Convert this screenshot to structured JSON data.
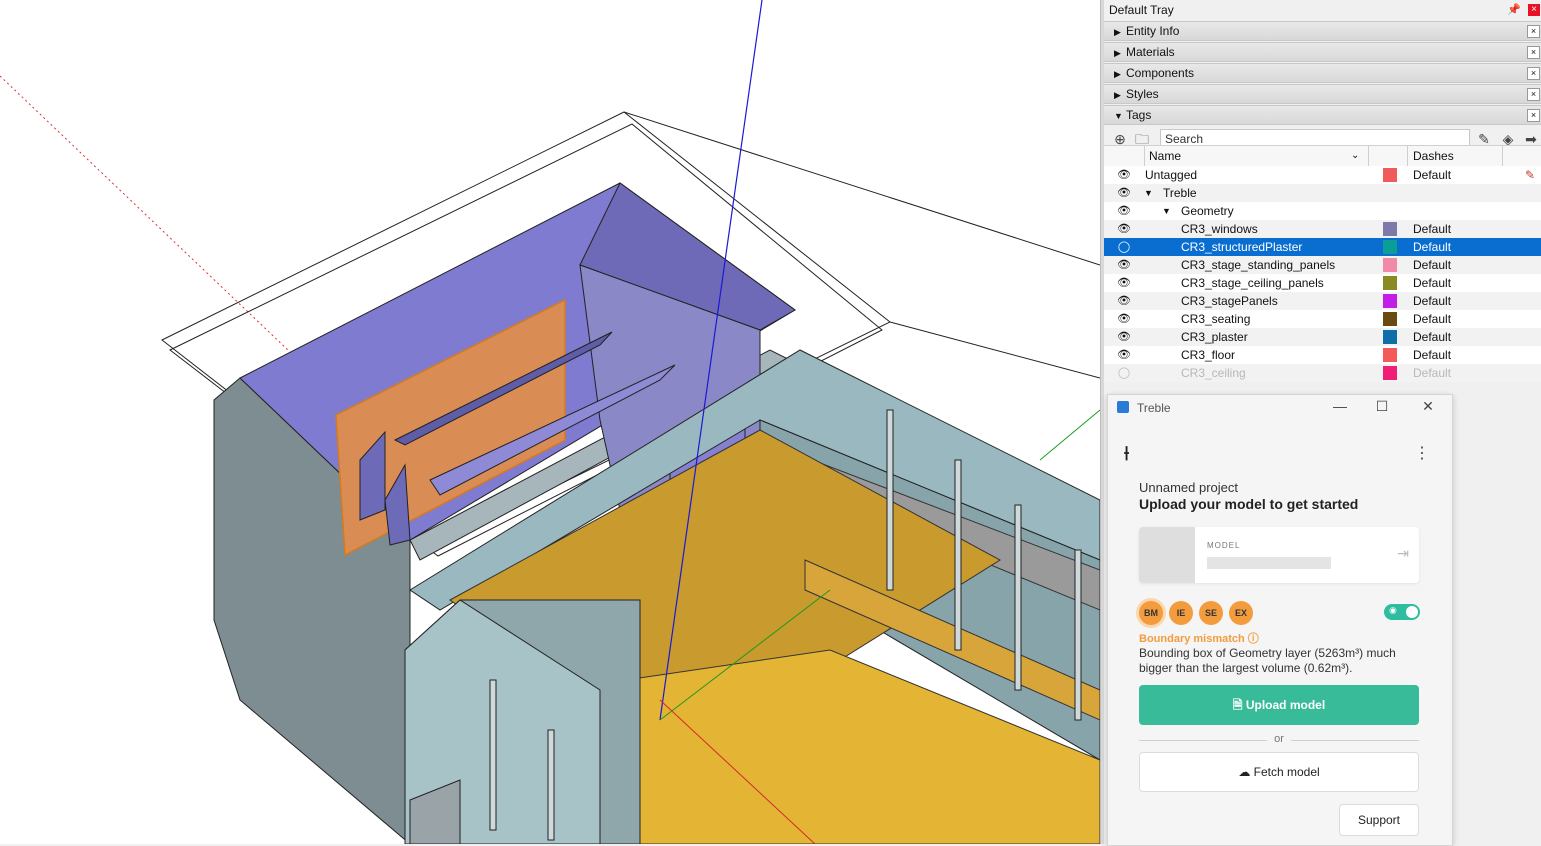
{
  "tray": {
    "title": "Default Tray",
    "pin_icon": "pin-icon",
    "close_label": "×",
    "panels": [
      {
        "label": "Entity Info",
        "expanded": false
      },
      {
        "label": "Materials",
        "expanded": false
      },
      {
        "label": "Components",
        "expanded": false
      },
      {
        "label": "Styles",
        "expanded": false
      },
      {
        "label": "Tags",
        "expanded": true
      }
    ],
    "panel_close_label": "×",
    "collapsed_glyph": "▶",
    "expanded_glyph": "▼"
  },
  "tags": {
    "search_placeholder": "Search",
    "toolbar_icons": [
      "add-tag-icon",
      "add-folder-icon",
      "paint-icon",
      "color-by-tag-icon",
      "details-icon"
    ],
    "columns": {
      "name": "Name",
      "dashes": "Dashes"
    },
    "rows": [
      {
        "name": "Untagged",
        "level": 0,
        "expander": "",
        "color": "#f15a5a",
        "dash": "Default",
        "visible": true,
        "active": true
      },
      {
        "name": "Treble",
        "level": 1,
        "expander": "▼",
        "color": "",
        "dash": "",
        "visible": true
      },
      {
        "name": "Geometry",
        "level": 2,
        "expander": "▼",
        "color": "",
        "dash": "",
        "visible": true
      },
      {
        "name": "CR3_windows",
        "level": 3,
        "expander": "",
        "color": "#7c7aa8",
        "dash": "Default",
        "visible": true
      },
      {
        "name": "CR3_structuredPlaster",
        "level": 3,
        "expander": "",
        "color": "#0a9e96",
        "dash": "Default",
        "visible": false,
        "selected": true
      },
      {
        "name": "CR3_stage_standing_panels",
        "level": 3,
        "expander": "",
        "color": "#f08aa8",
        "dash": "Default",
        "visible": true
      },
      {
        "name": "CR3_stage_ceiling_panels",
        "level": 3,
        "expander": "",
        "color": "#8a8a22",
        "dash": "Default",
        "visible": true
      },
      {
        "name": "CR3_stagePanels",
        "level": 3,
        "expander": "",
        "color": "#c21ee6",
        "dash": "Default",
        "visible": true
      },
      {
        "name": "CR3_seating",
        "level": 3,
        "expander": "",
        "color": "#6b4a12",
        "dash": "Default",
        "visible": true
      },
      {
        "name": "CR3_plaster",
        "level": 3,
        "expander": "",
        "color": "#0e6fa8",
        "dash": "Default",
        "visible": true
      },
      {
        "name": "CR3_floor",
        "level": 3,
        "expander": "",
        "color": "#f45a5a",
        "dash": "Default",
        "visible": true
      },
      {
        "name": "CR3_ceiling",
        "level": 3,
        "expander": "",
        "color": "#ef1f76",
        "dash": "Default",
        "visible": false,
        "dim": true
      }
    ]
  },
  "treble": {
    "window_title": "Treble",
    "project_name": "Unnamed project",
    "cta": "Upload your model to get started",
    "model_label": "MODEL",
    "checks": [
      {
        "label": "BM",
        "active": true
      },
      {
        "label": "IE",
        "active": false
      },
      {
        "label": "SE",
        "active": false
      },
      {
        "label": "EX",
        "active": false
      }
    ],
    "warning_title": "Boundary mismatch ⓘ",
    "warning_body": "Bounding box of Geometry layer (5263m³) much bigger than the largest volume (0.62m³).",
    "upload_label": "Upload model",
    "or_label": "or",
    "fetch_label": "Fetch model",
    "support_label": "Support",
    "minimize_glyph": "—",
    "maximize_glyph": "☐",
    "close_glyph": "✕",
    "menu_glyph": "⋮"
  },
  "colors": {
    "selection": "#0a6ed1",
    "accent_green": "#37bb99",
    "warning_orange": "#f39c3d"
  }
}
